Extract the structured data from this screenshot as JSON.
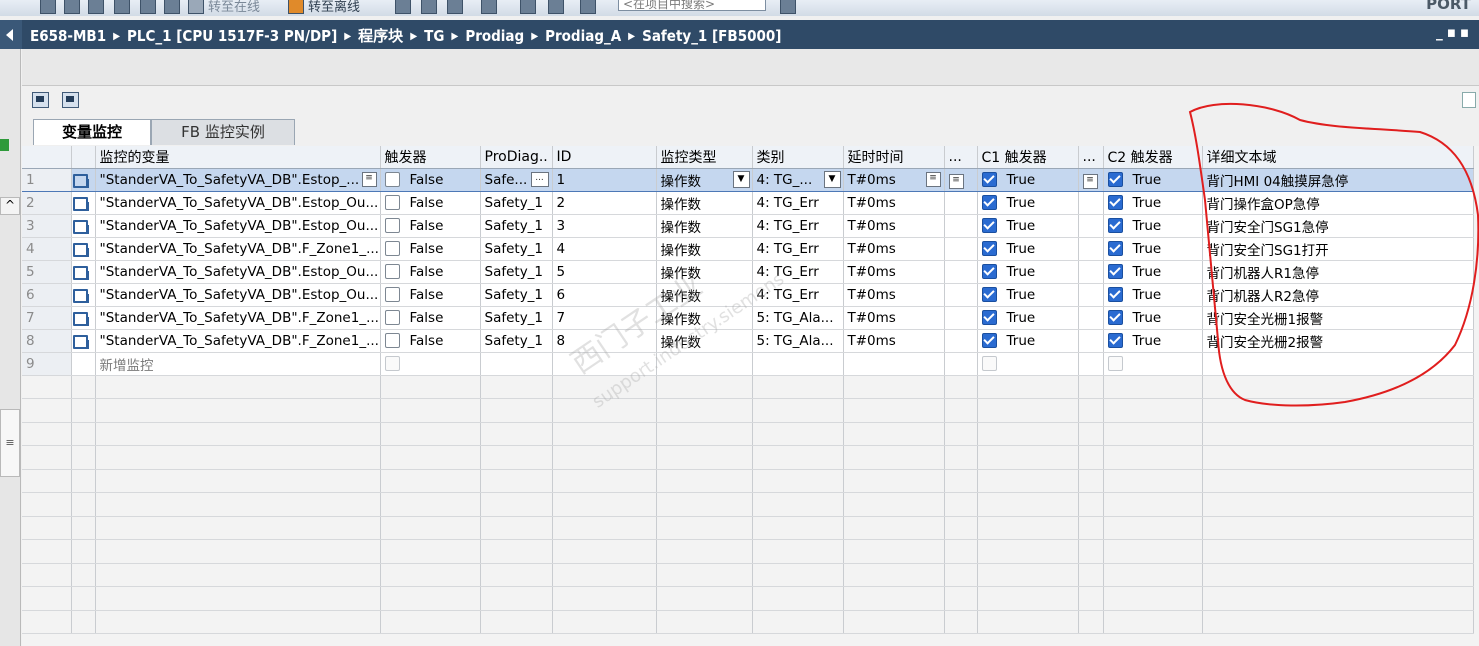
{
  "toolbar": {
    "go_online": "转至在线",
    "go_offline": "转至离线",
    "search_placeholder": "<在项目中搜索>",
    "right_text": "PORT"
  },
  "breadcrumb": {
    "items": [
      "E658-MB1",
      "PLC_1 [CPU 1517F-3 PN/DP]",
      "程序块",
      "TG",
      "Prodiag",
      "Prodiag_A",
      "Safety_1 [FB5000]"
    ]
  },
  "tabs": [
    {
      "label": "变量监控"
    },
    {
      "label": "FB 监控实例"
    }
  ],
  "grid": {
    "headers": {
      "variable": "监控的变量",
      "trigger": "触发器",
      "prodiag": "ProDiag..",
      "id": "ID",
      "monitor_type": "监控类型",
      "category": "类别",
      "delay": "延时时间",
      "dots1": "...",
      "c1": "C1 触发器",
      "dots2": "...",
      "c2": "C2 触发器",
      "detail": "详细文本域"
    },
    "rows": [
      {
        "num": "1",
        "variable": "\"StanderVA_To_SafetyVA_DB\".Estop_...",
        "trigger": "False",
        "prodiag": "Safe...",
        "id": "1",
        "monitor_type": "操作数",
        "category": "4: TG_...",
        "delay": "T#0ms",
        "c1": "True",
        "c2": "True",
        "detail": "背门HMI 04触摸屏急停"
      },
      {
        "num": "2",
        "variable": "\"StanderVA_To_SafetyVA_DB\".Estop_Ou...",
        "trigger": "False",
        "prodiag": "Safety_1",
        "id": "2",
        "monitor_type": "操作数",
        "category": "4: TG_Err",
        "delay": "T#0ms",
        "c1": "True",
        "c2": "True",
        "detail": "背门操作盒OP急停"
      },
      {
        "num": "3",
        "variable": "\"StanderVA_To_SafetyVA_DB\".Estop_Ou...",
        "trigger": "False",
        "prodiag": "Safety_1",
        "id": "3",
        "monitor_type": "操作数",
        "category": "4: TG_Err",
        "delay": "T#0ms",
        "c1": "True",
        "c2": "True",
        "detail": "背门安全门SG1急停"
      },
      {
        "num": "4",
        "variable": "\"StanderVA_To_SafetyVA_DB\".F_Zone1_...",
        "trigger": "False",
        "prodiag": "Safety_1",
        "id": "4",
        "monitor_type": "操作数",
        "category": "4: TG_Err",
        "delay": "T#0ms",
        "c1": "True",
        "c2": "True",
        "detail": "背门安全门SG1打开"
      },
      {
        "num": "5",
        "variable": "\"StanderVA_To_SafetyVA_DB\".Estop_Ou...",
        "trigger": "False",
        "prodiag": "Safety_1",
        "id": "5",
        "monitor_type": "操作数",
        "category": "4: TG_Err",
        "delay": "T#0ms",
        "c1": "True",
        "c2": "True",
        "detail": "背门机器人R1急停"
      },
      {
        "num": "6",
        "variable": "\"StanderVA_To_SafetyVA_DB\".Estop_Ou...",
        "trigger": "False",
        "prodiag": "Safety_1",
        "id": "6",
        "monitor_type": "操作数",
        "category": "4: TG_Err",
        "delay": "T#0ms",
        "c1": "True",
        "c2": "True",
        "detail": "背门机器人R2急停"
      },
      {
        "num": "7",
        "variable": "\"StanderVA_To_SafetyVA_DB\".F_Zone1_...",
        "trigger": "False",
        "prodiag": "Safety_1",
        "id": "7",
        "monitor_type": "操作数",
        "category": "5: TG_Ala...",
        "delay": "T#0ms",
        "c1": "True",
        "c2": "True",
        "detail": "背门安全光栅1报警"
      },
      {
        "num": "8",
        "variable": "\"StanderVA_To_SafetyVA_DB\".F_Zone1_...",
        "trigger": "False",
        "prodiag": "Safety_1",
        "id": "8",
        "monitor_type": "操作数",
        "category": "5: TG_Ala...",
        "delay": "T#0ms",
        "c1": "True",
        "c2": "True",
        "detail": "背门安全光栅2报警"
      }
    ],
    "new_row": {
      "num": "9",
      "label": "新增监控"
    }
  },
  "watermark": {
    "text1": "西门子工业",
    "text2": "support.industry.siemens"
  },
  "colors": {
    "breadcrumb_bg": "#2f4a67",
    "selection": "#c5d7ef",
    "checkbox_on": "#2a6bd1",
    "annotation": "#e01e1e"
  }
}
